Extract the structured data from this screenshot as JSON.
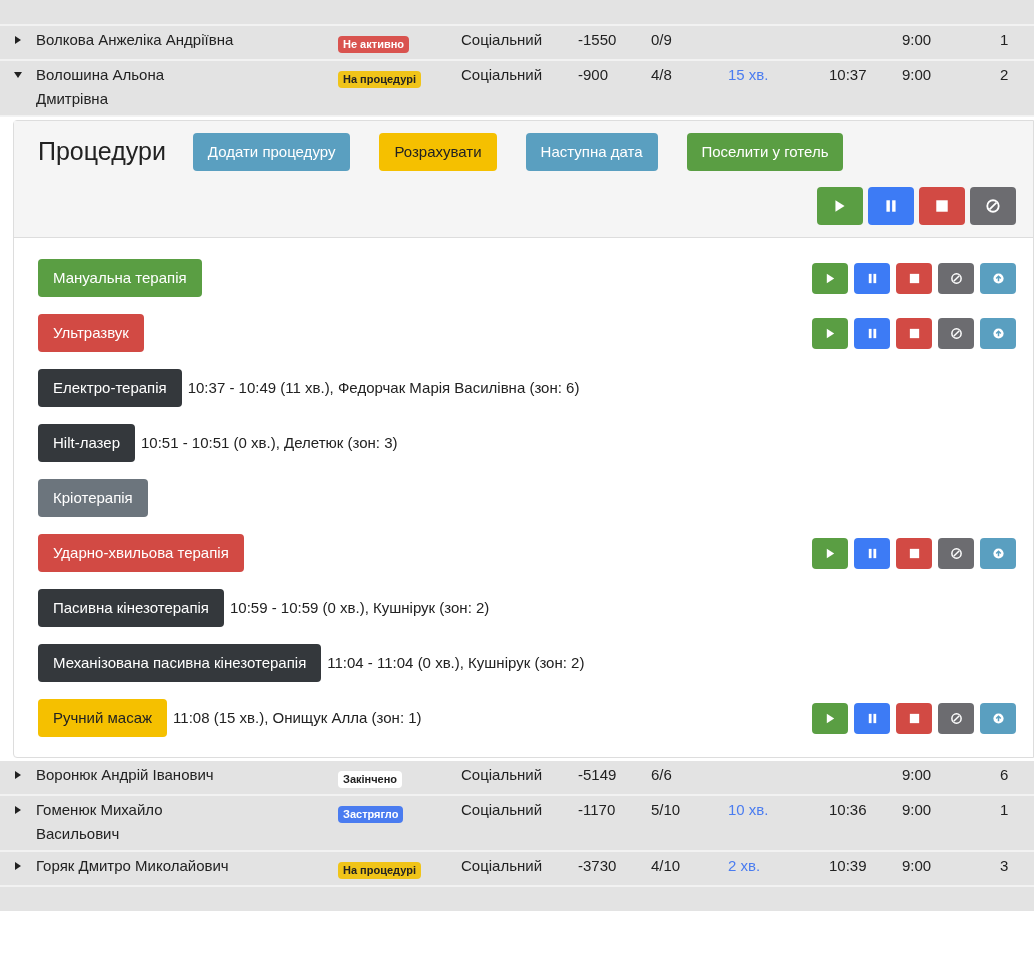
{
  "patients": [
    {
      "name": "Волкова Анжеліка Андріївна",
      "expanded": false,
      "status": {
        "label": "Не активно",
        "color": "#d9534f"
      },
      "type": "Соціальний",
      "balance": "-1550",
      "sessions": "0/9",
      "time": "9:00",
      "count": "1"
    },
    {
      "name": "Волошина Альона Дмитрівна",
      "expanded": true,
      "status": {
        "label": "На процедурі",
        "color": "#f0c419"
      },
      "type": "Соціальний",
      "balance": "-900",
      "sessions": "4/8",
      "waiting": "15 хв.",
      "started": "10:37",
      "time": "9:00",
      "count": "2",
      "panel": {
        "title": "Процедури",
        "actions": [
          {
            "label": "Додати процедуру",
            "color": "#5a9fc0"
          },
          {
            "label": "Розрахувати",
            "color": "#f5c000"
          },
          {
            "label": "Наступна дата",
            "color": "#5a9fc0"
          },
          {
            "label": "Поселити у готель",
            "color": "#5a9e43"
          }
        ],
        "procedures": [
          {
            "label": "Мануальна терапія",
            "color": "#5a9e43",
            "controls": true
          },
          {
            "label": "Ультразвук",
            "color": "#d24a44",
            "controls": true
          },
          {
            "label": "Електро-терапія",
            "color": "#34383c",
            "controls": false,
            "detail": "10:37 - 10:49 (11 хв.), Федорчак Марія Василівна (зон: 6)"
          },
          {
            "label": "Hilt-лазер",
            "color": "#34383c",
            "controls": false,
            "detail": "10:51 - 10:51 (0 хв.), Делетюк (зон: 3)"
          },
          {
            "label": "Кріотерапія",
            "color": "#6c757d",
            "controls": false
          },
          {
            "label": "Ударно-хвильова терапія",
            "color": "#d24a44",
            "controls": true
          },
          {
            "label": "Пасивна кінезотерапія",
            "color": "#34383c",
            "controls": false,
            "detail": "10:59 - 10:59 (0 хв.), Кушнірук (зон: 2)"
          },
          {
            "label": "Механізована пасивна кінезотерапія",
            "color": "#34383c",
            "controls": false,
            "detail": "11:04 - 11:04 (0 хв.), Кушнірук (зон: 2)"
          },
          {
            "label": "Ручний масаж",
            "color": "#f5c000",
            "controls": true,
            "detail": "11:08 (15 хв.), Онищук Алла (зон: 1)"
          }
        ]
      }
    },
    {
      "name": "Воронюк Андрій Іванович",
      "expanded": false,
      "status": {
        "label": "Закінчено",
        "color": "#ffffff"
      },
      "type": "Соціальний",
      "balance": "-5149",
      "sessions": "6/6",
      "time": "9:00",
      "count": "6"
    },
    {
      "name": "Гоменюк Михайло Васильович",
      "expanded": false,
      "status": {
        "label": "Застрягло",
        "color": "#4a7cf0"
      },
      "type": "Соціальний",
      "balance": "-1170",
      "sessions": "5/10",
      "waiting": "10 хв.",
      "started": "10:36",
      "time": "9:00",
      "count": "1"
    },
    {
      "name": "Горяк Дмитро Миколайович",
      "expanded": false,
      "status": {
        "label": "На процедурі",
        "color": "#f0c419"
      },
      "type": "Соціальний",
      "balance": "-3730",
      "sessions": "4/10",
      "waiting": "2 хв.",
      "started": "10:39",
      "time": "9:00",
      "count": "3"
    }
  ]
}
